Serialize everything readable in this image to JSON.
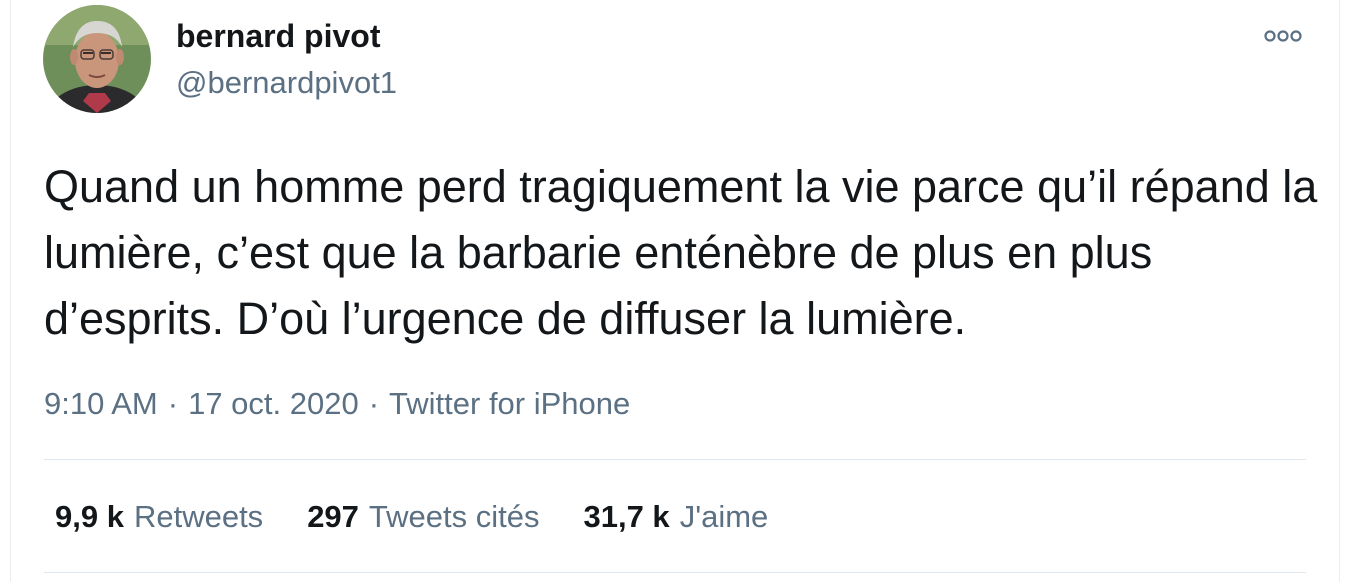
{
  "author": {
    "name": "bernard pivot",
    "handle": "@bernardpivot1",
    "avatar_icon": "profile-photo"
  },
  "tweet": {
    "text": "Quand un homme perd tragiquement la vie parce qu’il répand la lumière, c’est que la barbarie enténèbre de plus en plus d’esprits. D’où l’urgence de diffuser la lumière.",
    "time": "9:10 AM",
    "date": "17 oct. 2020",
    "source": "Twitter for iPhone",
    "separator": "·"
  },
  "stats": [
    {
      "value": "9,9 k",
      "label": "Retweets"
    },
    {
      "value": "297",
      "label": "Tweets cités"
    },
    {
      "value": "31,7 k",
      "label": "J'aime"
    }
  ],
  "menu": {
    "icon": "more-options-icon"
  },
  "colors": {
    "text_primary": "#14171a",
    "text_secondary": "#5b7083",
    "divider": "#e1e8ed"
  }
}
